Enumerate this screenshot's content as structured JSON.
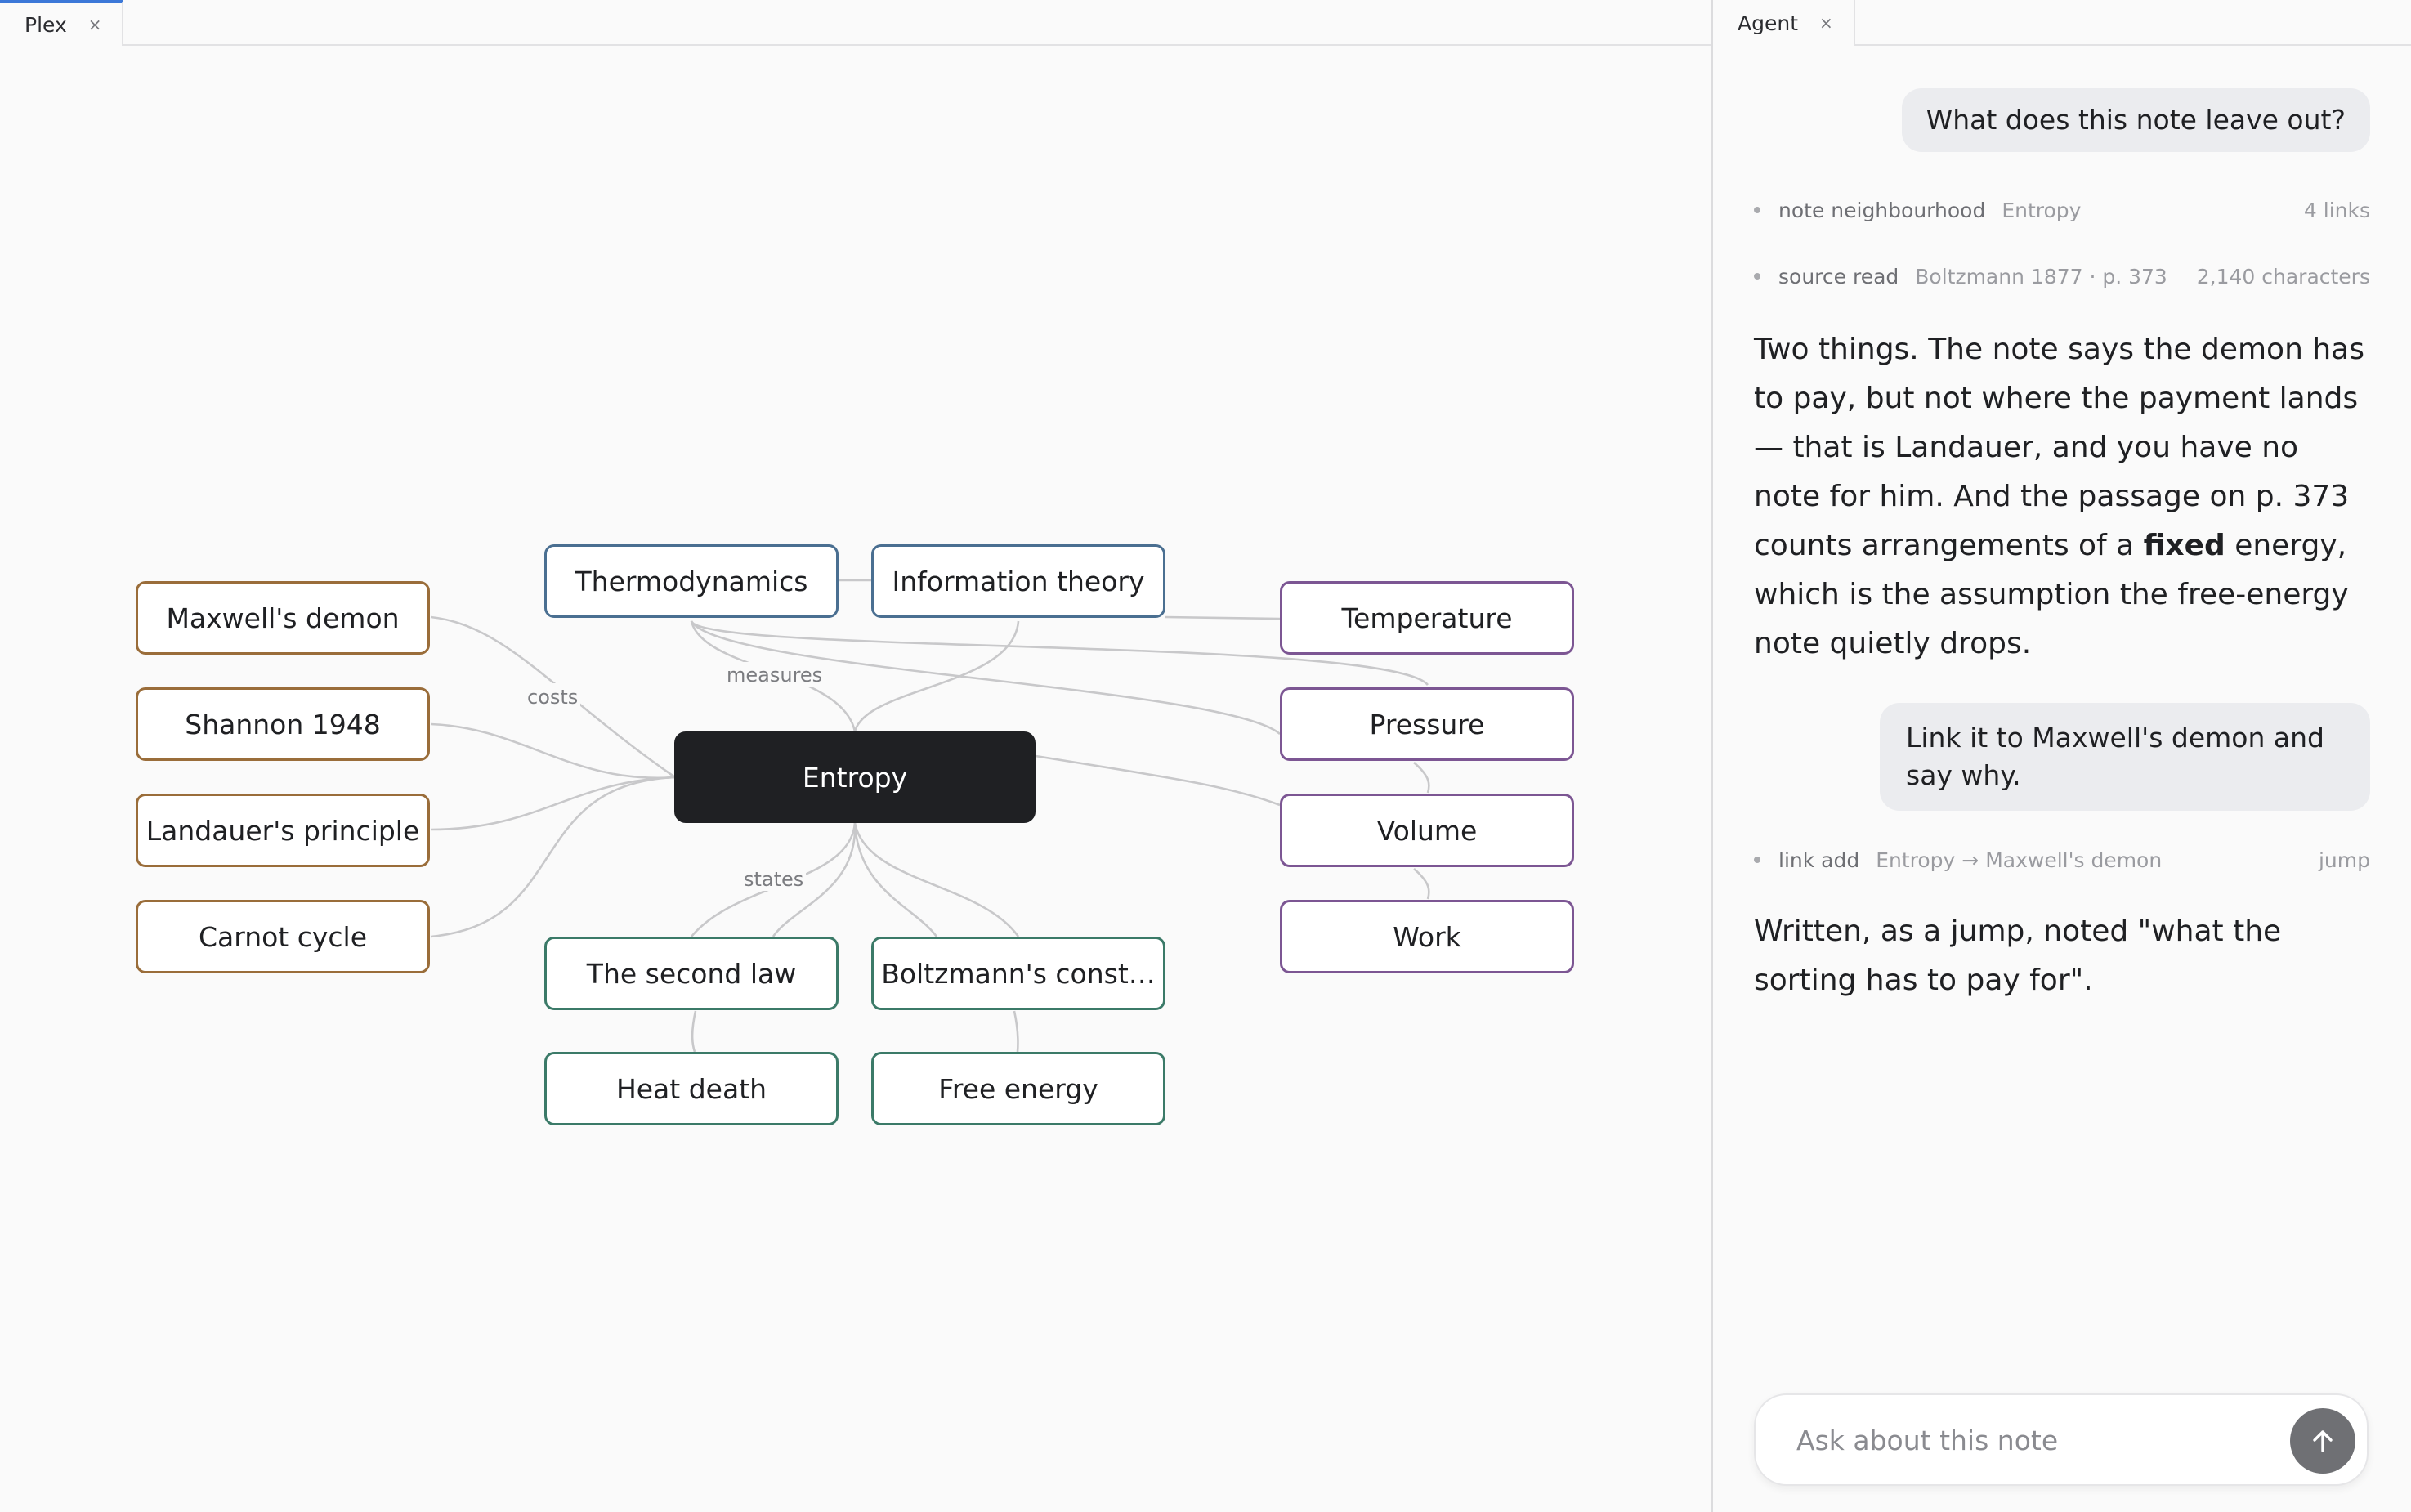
{
  "left_tab": {
    "label": "Plex",
    "close": "×"
  },
  "right_tab": {
    "label": "Agent",
    "close": "×"
  },
  "graph": {
    "center": "Entropy",
    "nodes": {
      "maxwells_demon": "Maxwell's demon",
      "shannon": "Shannon 1948",
      "landauer": "Landauer's principle",
      "carnot": "Carnot cycle",
      "thermodynamics": "Thermodynamics",
      "information_theory": "Information theory",
      "second_law": "The second law",
      "boltzmann": "Boltzmann's const…",
      "heat_death": "Heat death",
      "free_energy": "Free energy",
      "temperature": "Temperature",
      "pressure": "Pressure",
      "volume": "Volume",
      "work": "Work"
    },
    "edge_labels": {
      "costs": "costs",
      "measures": "measures",
      "states": "states"
    },
    "colors": {
      "brown": "#9a6d3a",
      "blue": "#4a6f91",
      "green": "#3b7a68",
      "purple": "#7c5693",
      "center": "#1f2023"
    }
  },
  "agent": {
    "messages": {
      "user1": "What does this note leave out?",
      "user2": "Link it to Maxwell's demon and say why."
    },
    "tools": [
      {
        "name": "note neighbourhood",
        "detail": "Entropy",
        "meta": "4 links"
      },
      {
        "name": "source read",
        "detail": "Boltzmann 1877 · p. 373",
        "meta": "2,140 characters"
      },
      {
        "name": "link add",
        "detail": "Entropy → Maxwell's demon",
        "meta": "jump"
      }
    ],
    "reply1": {
      "before": "Two things. The note says the demon has to pay, but not where the payment lands — that is Landauer, and you have no note for him. And the passage on p. 373 counts arrangements of a ",
      "bold": "fixed",
      "after": " energy, which is the assumption the free-energy note quietly drops."
    },
    "reply2": "Written, as a jump, noted \"what the sorting has to pay for\".",
    "input": {
      "placeholder": "Ask about this note",
      "value": ""
    },
    "send_icon": "arrow-up-icon"
  }
}
